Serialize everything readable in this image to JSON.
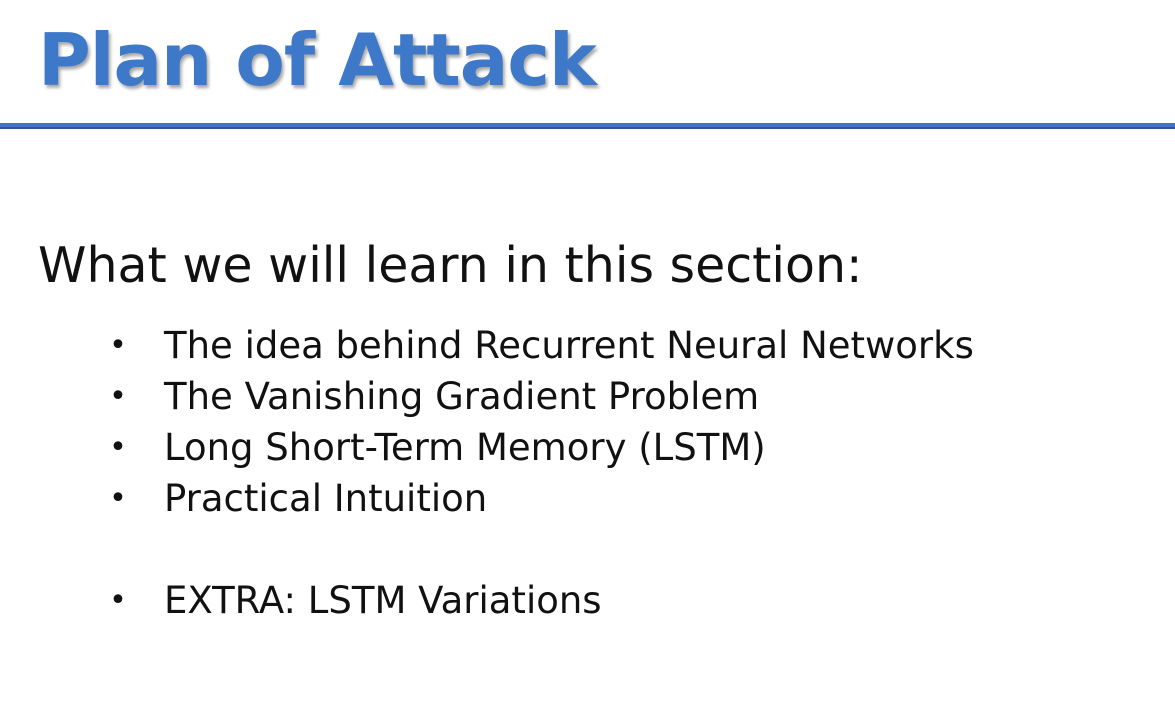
{
  "slide": {
    "title": "Plan of Attack",
    "heading": "What we will learn in this section:",
    "bullet_symbol": "•",
    "bullets": [
      "The idea behind Recurrent Neural Networks",
      "The Vanishing Gradient Problem",
      "Long Short-Term Memory (LSTM)",
      "Practical Intuition",
      "EXTRA: LSTM Variations"
    ]
  },
  "colors": {
    "title": "#3d79c8",
    "rule": "#4472c4",
    "text": "#111111",
    "background": "#ffffff"
  }
}
